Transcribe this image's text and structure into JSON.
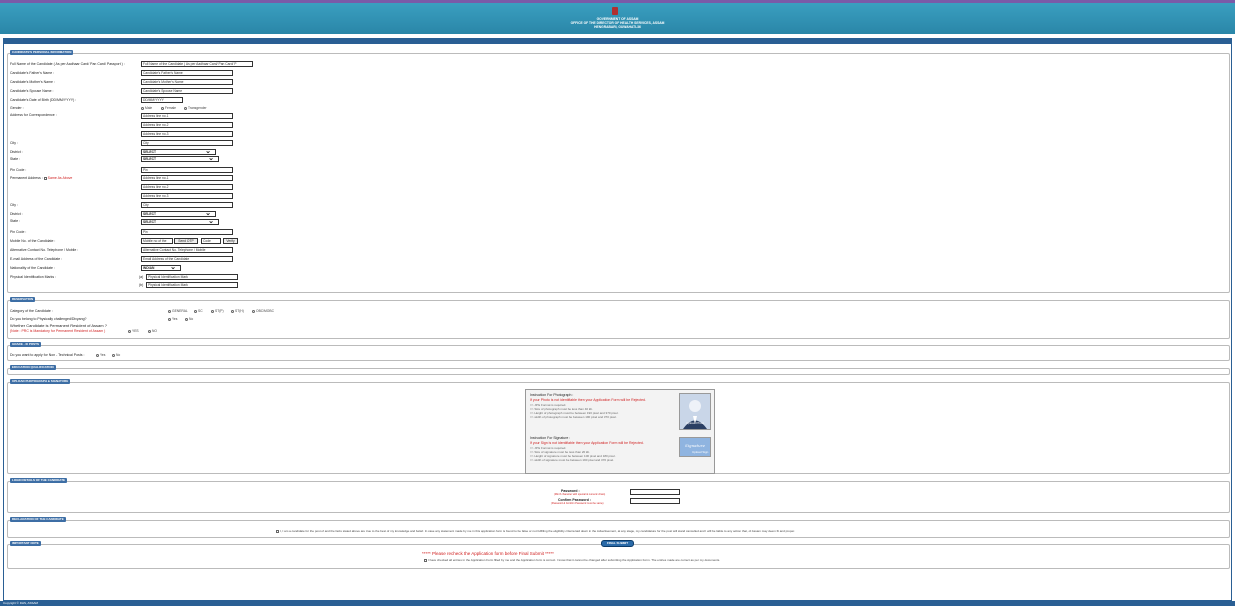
{
  "header": {
    "line1": "GOVERNMENT OF ASSAM",
    "line2": "OFFICE OF THE DIRECTOR OF HEALTH SERVICES, ASSAM",
    "line3": "HENGRABARI, GUWAHATI-36"
  },
  "sections": {
    "personal": "CANDIDATE'S PERSONAL INFORMATION",
    "reservation": "RESERVATION",
    "grade": "GRADE - III POSTS",
    "education": "EDUCATION QUALIFICATION",
    "upload": "UPLOAD PHOTOGRAPH & SIGNATURE",
    "login": "LOGIN DETAILS OF THE CANDIDATE",
    "declaration": "DECLARATION OF THE CANDIDATE",
    "note": "IMPORTANT NOTE"
  },
  "personal": {
    "full_name_label": "Full Name of the Candidate ( As per Aadhaar Card/ Pan Card/ Passport ) :",
    "full_name_placeholder": "Full Name of the Candidate ( As per Aadhaar Card/ Pan Card/ P",
    "father_label": "Candidate's Father's Name :",
    "father_placeholder": "Candidate's Father's Name",
    "mother_label": "Candidate's Mother's Name :",
    "mother_placeholder": "Candidate's Mother's Name",
    "spouse_label": "Candidate's Spouse Name :",
    "spouse_placeholder": "Candidate's Spouse Name",
    "dob_label": "Candidate's Date of Birth (DD/MM/YYYY) :",
    "dob_placeholder": "DD/MM/YYYY",
    "gender_label": "Gender :",
    "gender_options": [
      "Male",
      "Female",
      "Transgender"
    ],
    "addr_label": "Address for Correspondence :",
    "addr1": "Address line no.1",
    "addr2": "Address line no.2",
    "addr3": "Address line no.3",
    "city_label": "City :",
    "city_placeholder": "City",
    "district_label": "District :",
    "state_label": "State :",
    "select_value": "SELECT",
    "pin_label": "Pin Code :",
    "pin_placeholder": "Pin",
    "perm_addr_label": "Permanent Address :",
    "same_as_above": "Same As Above",
    "mobile_label": "Mobile No. of the Candidate :",
    "mobile_placeholder": "Mobile no of the",
    "send_otp": "Send OTP",
    "otp_code": "Code",
    "verify": "Verify",
    "alt_label": "Alternative Contact No. Telephone / Mobile :",
    "alt_placeholder": "Alternative Contact No. Telephone / Mobile",
    "email_label": "E-mail Address of the Candidate :",
    "email_placeholder": "Email Address of the Candidate",
    "nationality_label": "Nationality of the Candidate :",
    "nationality_value": "INDIAN",
    "marks_label": "Physical Identification Marks :",
    "mark_a": "(a)",
    "mark_b": "(b)",
    "marks_placeholder": "Physical Identification Mark"
  },
  "reservation": {
    "category_label": "Category of the Candidate :",
    "category_options": [
      "GENERAL",
      "SC",
      "ST(P)",
      "ST(H)",
      "OBC/MOBC"
    ],
    "disabled_label": "Do you belong to Physically challenged/Divyang?",
    "yes": "Yes",
    "no": "No",
    "resident_label": "Whether Candidate is Permanent Resident of Assam ?",
    "resident_note": "(Note : PRC is Mandatory for Permanent Resident of Assam )",
    "yes_caps": "YES",
    "no_caps": "NO"
  },
  "grade": {
    "question": "Do you want to apply for Non - Technical Posts :"
  },
  "upload": {
    "photo_title": "Instruction For Photograph :",
    "photo_warn": "If your Photo is not identifiable then your Application Form will be Rejected.",
    "photo_rules": [
      "=> JPG Format is required.",
      "=> Size of photograph must be less than 40 kb.",
      "=> Height of photograph must be between 190 pixel and 370 pixel.",
      "=> width of photograph must be between 190 pixel and 370 pixel."
    ],
    "photo_caption": "Upload Photo",
    "sign_title": "Instruction For Signature :",
    "sign_warn": "If your Sign is not identifiable then your Application Form will be Rejected.",
    "sign_rules": [
      "=> JPG Format is required.",
      "=> Size of signature must be less than 20 kb.",
      "=> Height of signature must be between 100 pixel and 180 pixel.",
      "=> width of signature must be between 190 pixel and 370 pixel."
    ],
    "sign_caption": "Signature",
    "sign_caption2": "Upload Sign"
  },
  "login": {
    "password_label": "Password :",
    "password_hint": "(Min 8 character with special & numeric chars)",
    "confirm_label": "Confirm Password :",
    "confirm_hint": "(Password & Confirm Password must be same)"
  },
  "declaration": {
    "text": "I, I am a candidate for the post of and the facts stated above are true to the best of my knowledge and belief. In case any statement made by me in this application form is found to be false or not fulfilling the eligibility criteria laid down in the Advertisement, at any stage, my candidature for the post will stand cancelled and I will be liable to any action that, of Assam may deem fit and proper."
  },
  "note": {
    "headline": "***** Please recheck the Application form before Final Submit *****",
    "text": "I have checked all entries in the Application Form filled by me and the Application form is correct. I know that it cannot be changed after submitting the Application Form. The entries made are correct as per my documents."
  },
  "final_submit": "FINAL SUBMIT",
  "footer": "Copyright © DHS, ASSAM",
  "colors": {
    "header": "#2a86a8",
    "band": "#2a5f94",
    "accent_red": "#d02020"
  }
}
